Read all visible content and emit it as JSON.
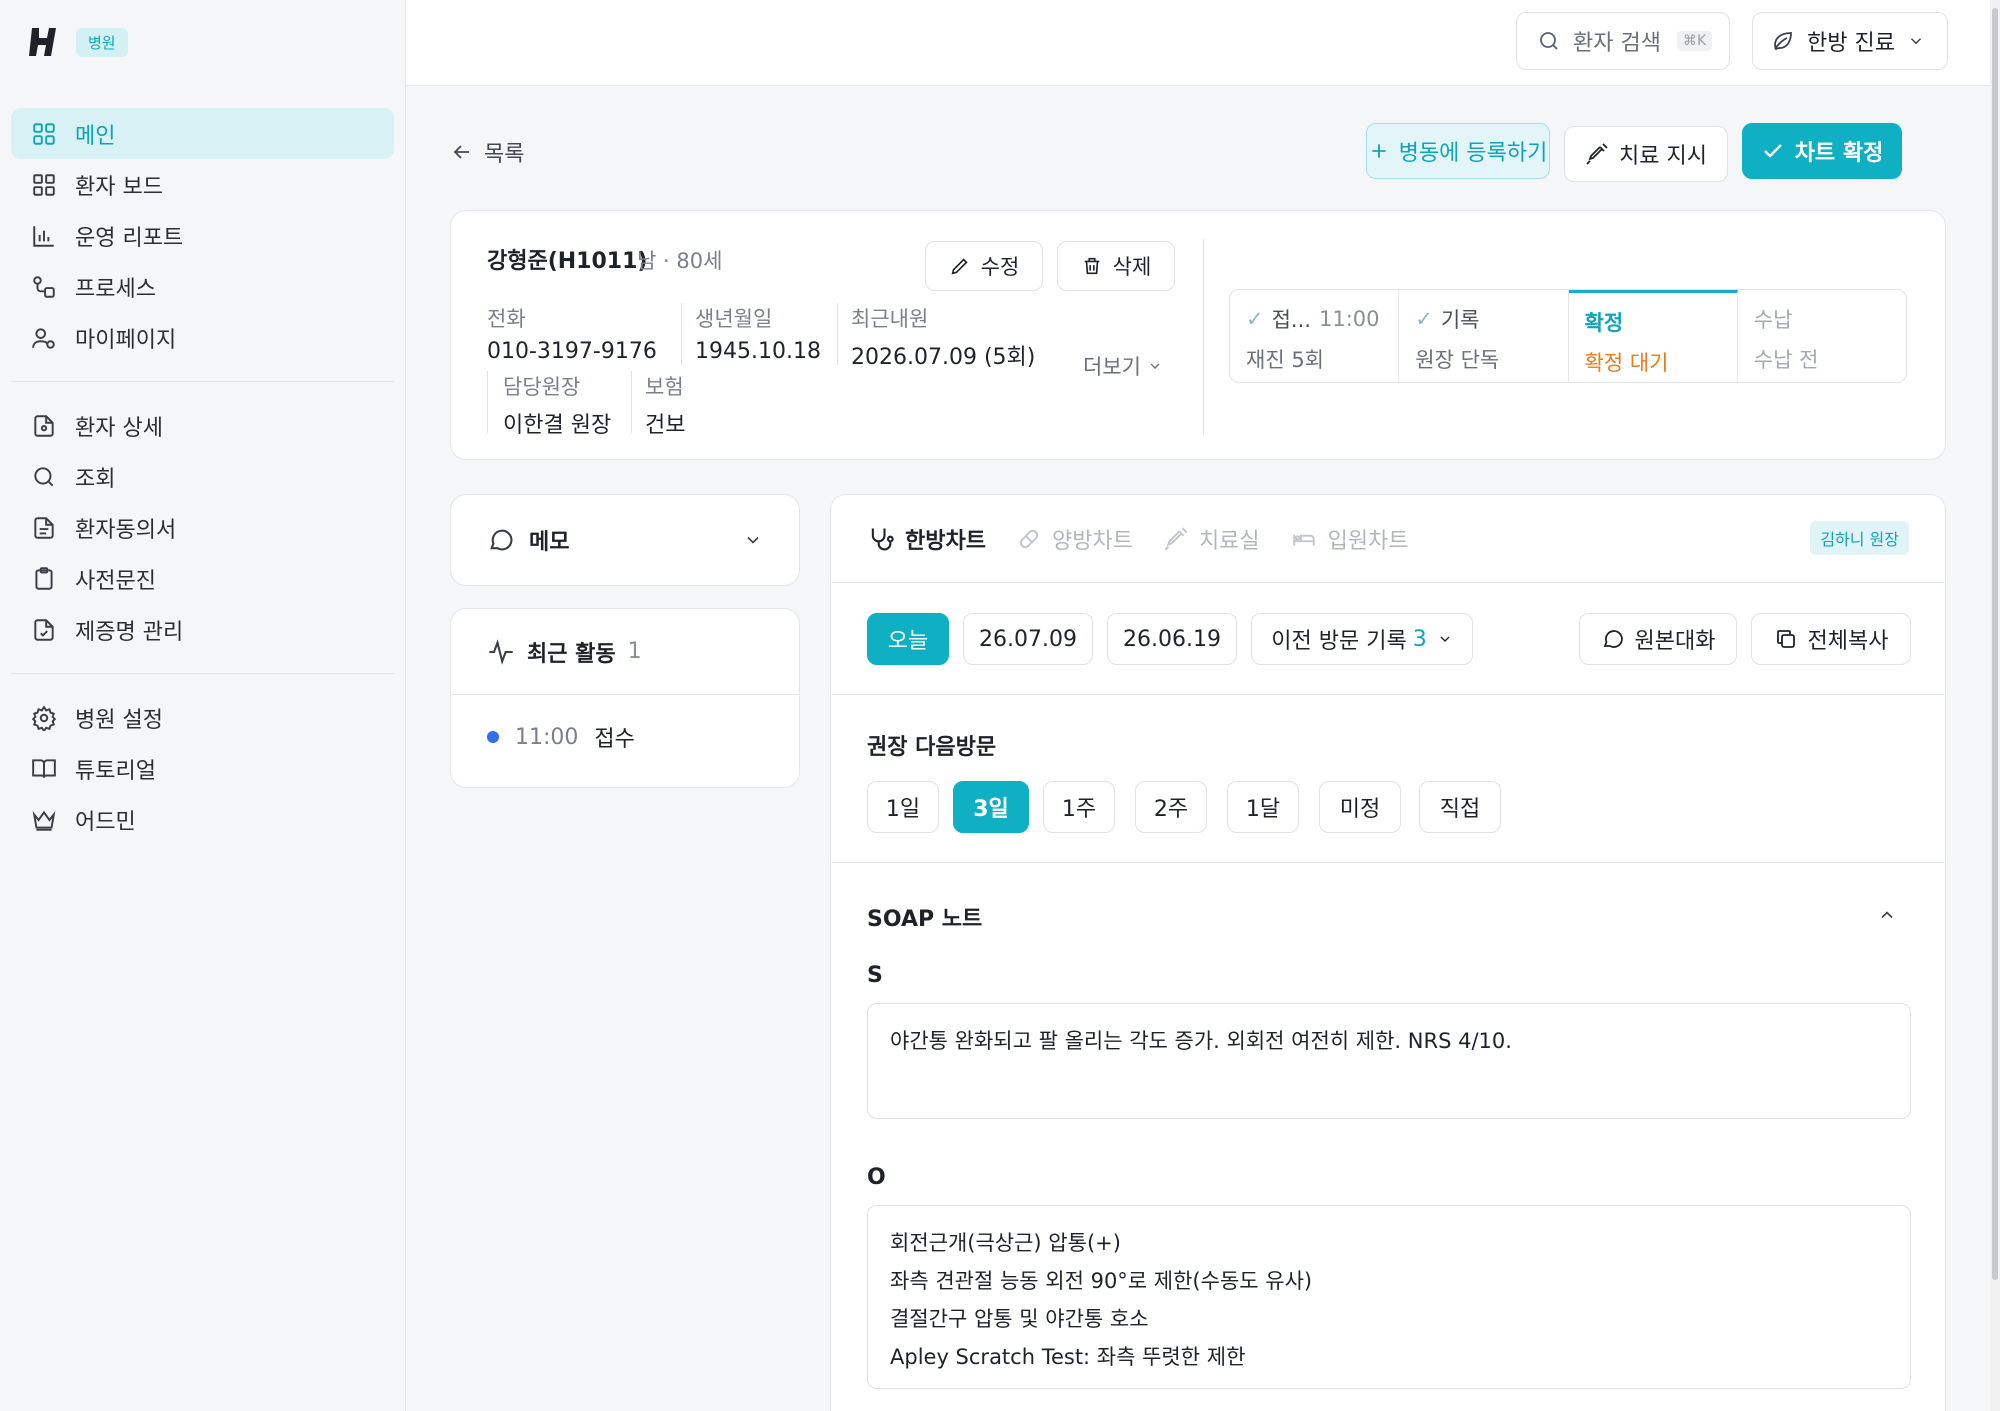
{
  "sidebar": {
    "badge": "병원",
    "group1": [
      "메인",
      "환자 보드",
      "운영 리포트",
      "프로세스",
      "마이페이지"
    ],
    "group2": [
      "환자 상세",
      "조회",
      "환자동의서",
      "사전문진",
      "제증명 관리"
    ],
    "group3": [
      "병원 설정",
      "튜토리얼",
      "어드민"
    ]
  },
  "topbar": {
    "search_label": "환자 검색",
    "search_shortcut": "⌘K",
    "mode_label": "한방 진료"
  },
  "header": {
    "back_label": "목록",
    "ward_button": "병동에 등록하기",
    "treat_button": "치료 지시",
    "confirm_button": "차트 확정"
  },
  "patient": {
    "name": "강형준(H1011)",
    "meta": "남 · 80세",
    "edit": "수정",
    "delete": "삭제",
    "phone_label": "전화",
    "phone": "010-3197-9176",
    "birth_label": "생년월일",
    "birth": "1945.10.18",
    "visit_label": "최근내원",
    "visit": "2026.07.09 (5회)",
    "doctor_label": "담당원장",
    "doctor": "이한결 원장",
    "insurance_label": "보험",
    "insurance": "건보",
    "more": "더보기"
  },
  "stages": [
    {
      "title": "접...",
      "time": "11:00",
      "sub": "재진 5회"
    },
    {
      "title": "기록",
      "time": "",
      "sub": "원장 단독"
    },
    {
      "title": "확정",
      "time": "",
      "sub": "확정 대기"
    },
    {
      "title": "수납",
      "time": "",
      "sub": "수납 전"
    }
  ],
  "memo": {
    "label": "메모"
  },
  "activity": {
    "label": "최근 활동",
    "count": "1",
    "time": "11:00",
    "event": "접수"
  },
  "chart_tabs": {
    "tab1": "한방차트",
    "tab2": "양방차트",
    "tab3": "치료실",
    "tab4": "입원차트",
    "doctor_badge": "김하니 원장"
  },
  "dates": {
    "today": "오늘",
    "d1": "26.07.09",
    "d2": "26.06.19",
    "prev_label": "이전 방문 기록",
    "prev_count": "3",
    "original": "원본대화",
    "copy_all": "전체복사"
  },
  "next_visit": {
    "title": "권장 다음방문",
    "options": [
      "1일",
      "3일",
      "1주",
      "2주",
      "1달",
      "미정",
      "직접"
    ],
    "selected": "3일"
  },
  "soap": {
    "title": "SOAP 노트",
    "s_label": "S",
    "s_text": "야간통 완화되고 팔 올리는 각도 증가. 외회전 여전히 제한. NRS 4/10.",
    "o_label": "O",
    "o_lines": [
      "회전근개(극상근) 압통(+)",
      "좌측 견관절 능동 외전 90°로 제한(수동도 유사)",
      "결절간구 압통 및 야간통 호소",
      "Apley Scratch Test: 좌측 뚜렷한 제한"
    ]
  },
  "colors": {
    "accent": "#0fb0c3",
    "warning": "#ea7a1a",
    "dot": "#2f6fed"
  }
}
